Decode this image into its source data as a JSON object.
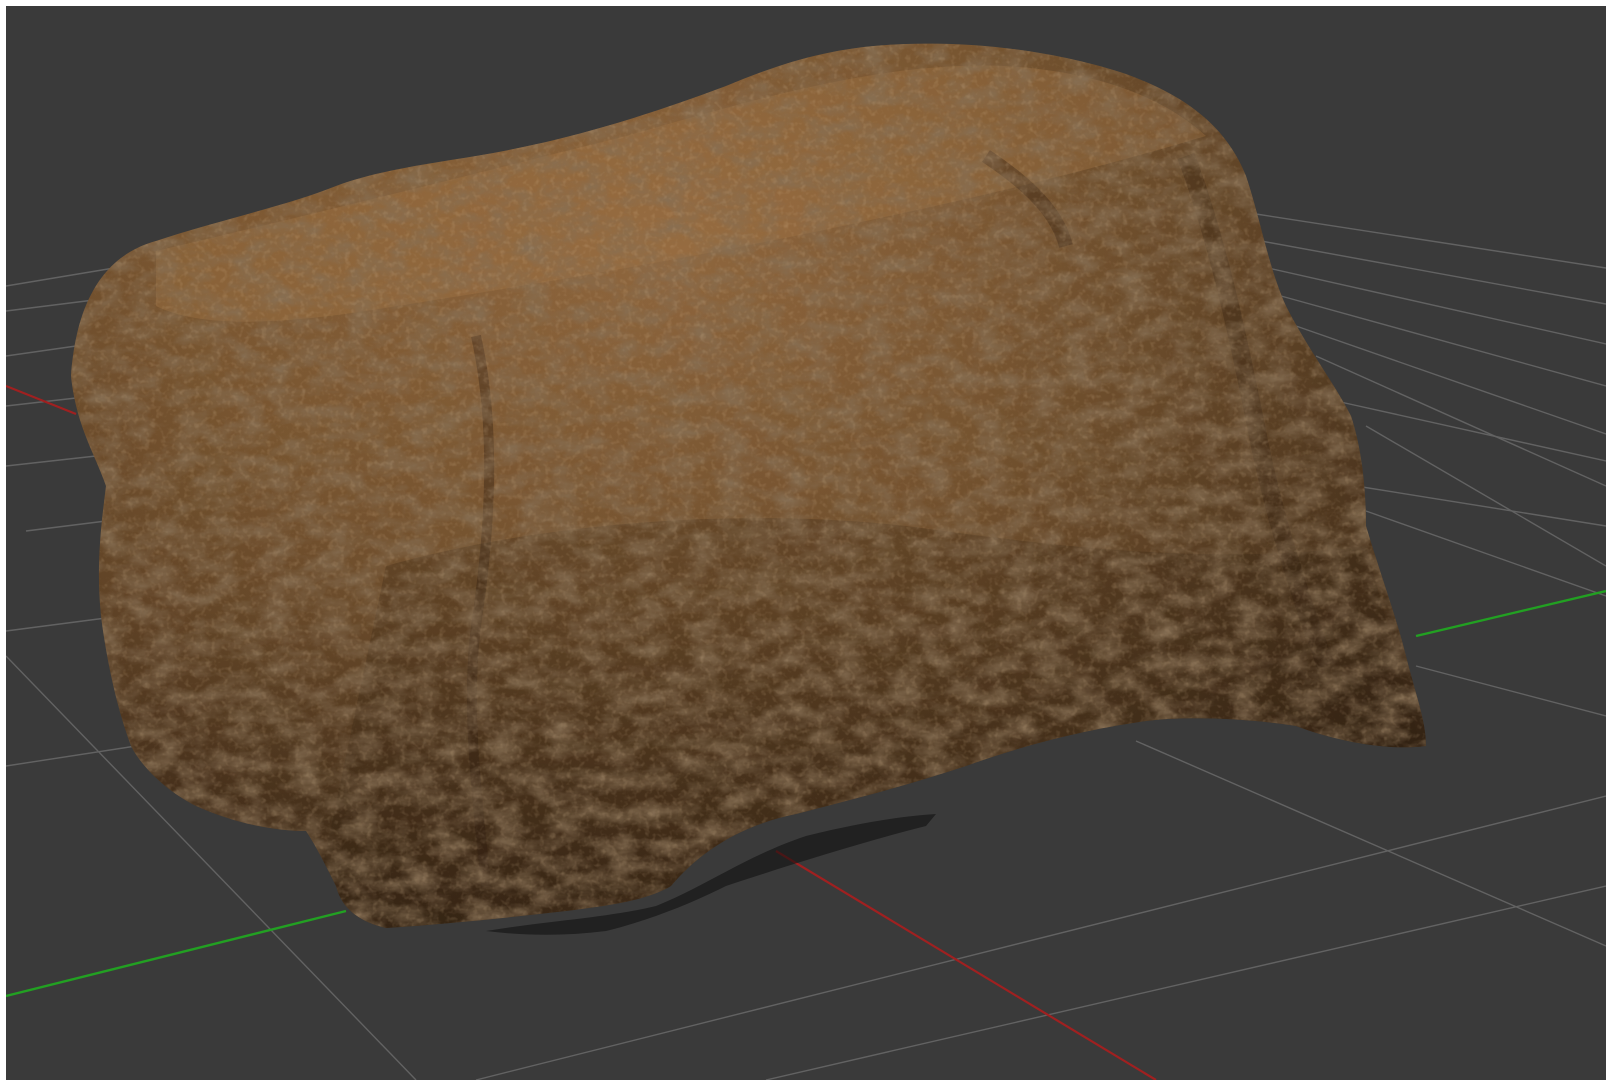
{
  "viewport": {
    "background_color": "#3a3a3a",
    "grid_color": "#6a6a6a",
    "x_axis_color": "#a02020",
    "y_axis_color": "#22a022",
    "object": {
      "name": "rock-mesh",
      "base_color": "#7a5530",
      "highlight_color": "#9a6e42",
      "shadow_color": "#3e2a17"
    }
  }
}
